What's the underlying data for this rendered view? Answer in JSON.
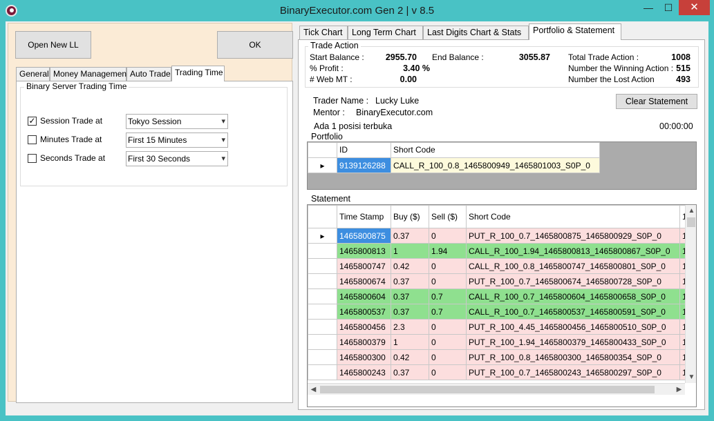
{
  "window": {
    "title": "BinaryExecutor.com Gen 2 | v 8.5",
    "minimize": "—",
    "maximize": "☐",
    "close": "✕"
  },
  "left": {
    "open_button": "Open New LL",
    "ok_button": "OK",
    "tabs": [
      "General",
      "Money Management",
      "Auto Trade",
      "Trading Time"
    ],
    "active_tab": "Trading Time",
    "group_title": "Binary Server Trading Time",
    "rows": [
      {
        "label": "Session Trade at",
        "checked": true,
        "value": "Tokyo Session"
      },
      {
        "label": "Minutes Trade at",
        "checked": false,
        "value": "First 15 Minutes"
      },
      {
        "label": "Seconds Trade at",
        "checked": false,
        "value": "First 30 Seconds"
      }
    ]
  },
  "right": {
    "tabs": [
      "Tick Chart",
      "Long Term Chart",
      "Last Digits Chart & Stats",
      "Portfolio & Statement"
    ],
    "active_tab": "Portfolio & Statement",
    "trade_action": {
      "title": "Trade Action",
      "start_balance_label": "Start Balance :",
      "start_balance": "2955.70",
      "end_balance_label": "End Balance :",
      "end_balance": "3055.87",
      "total_label": "Total Trade Action :",
      "total": "1008",
      "profit_label": "% Profit :",
      "profit": "3.40 %",
      "winning_label": "Number the Winning Action :",
      "winning": "515",
      "webmt_label": "# Web MT :",
      "webmt": "0.00",
      "lost_label": "Number the Lost Action",
      "lost": "493"
    },
    "trader_label": "Trader Name :",
    "trader_name": "Lucky Luke",
    "mentor_label": "Mentor :",
    "mentor": "BinaryExecutor.com",
    "open_positions": "Ada 1 posisi terbuka",
    "timer": "00:00:00",
    "clear_button": "Clear Statement",
    "portfolio": {
      "title": "Portfolio",
      "columns": [
        "ID",
        "Short Code"
      ],
      "rows": [
        {
          "id": "9139126288",
          "code": "CALL_R_100_0.8_1465800949_1465801003_S0P_0"
        }
      ]
    },
    "statement": {
      "title": "Statement",
      "columns": [
        "Time Stamp",
        "Buy ($)",
        "Sell ($)",
        "Short Code",
        "1"
      ],
      "rows": [
        {
          "ts": "1465800875",
          "buy": "0.37",
          "sell": "0",
          "code": "PUT_R_100_0.7_1465800875_1465800929_S0P_0",
          "extra": "1",
          "result": "loss"
        },
        {
          "ts": "1465800813",
          "buy": "1",
          "sell": "1.94",
          "code": "CALL_R_100_1.94_1465800813_1465800867_S0P_0",
          "extra": "1",
          "result": "win"
        },
        {
          "ts": "1465800747",
          "buy": "0.42",
          "sell": "0",
          "code": "CALL_R_100_0.8_1465800747_1465800801_S0P_0",
          "extra": "1",
          "result": "loss"
        },
        {
          "ts": "1465800674",
          "buy": "0.37",
          "sell": "0",
          "code": "PUT_R_100_0.7_1465800674_1465800728_S0P_0",
          "extra": "1",
          "result": "loss"
        },
        {
          "ts": "1465800604",
          "buy": "0.37",
          "sell": "0.7",
          "code": "CALL_R_100_0.7_1465800604_1465800658_S0P_0",
          "extra": "1",
          "result": "win"
        },
        {
          "ts": "1465800537",
          "buy": "0.37",
          "sell": "0.7",
          "code": "CALL_R_100_0.7_1465800537_1465800591_S0P_0",
          "extra": "1",
          "result": "win"
        },
        {
          "ts": "1465800456",
          "buy": "2.3",
          "sell": "0",
          "code": "PUT_R_100_4.45_1465800456_1465800510_S0P_0",
          "extra": "1",
          "result": "loss"
        },
        {
          "ts": "1465800379",
          "buy": "1",
          "sell": "0",
          "code": "PUT_R_100_1.94_1465800379_1465800433_S0P_0",
          "extra": "1",
          "result": "loss"
        },
        {
          "ts": "1465800300",
          "buy": "0.42",
          "sell": "0",
          "code": "PUT_R_100_0.8_1465800300_1465800354_S0P_0",
          "extra": "1",
          "result": "loss"
        },
        {
          "ts": "1465800243",
          "buy": "0.37",
          "sell": "0",
          "code": "PUT_R_100_0.7_1465800243_1465800297_S0P_0",
          "extra": "1",
          "result": "loss"
        }
      ]
    }
  },
  "colors": {
    "frame": "#49c2c5",
    "left_panel": "#fbebd6",
    "win_row": "#8fe08f",
    "loss_row": "#fcdede",
    "selected": "#3d8ee0",
    "close_button": "#c7403a"
  }
}
